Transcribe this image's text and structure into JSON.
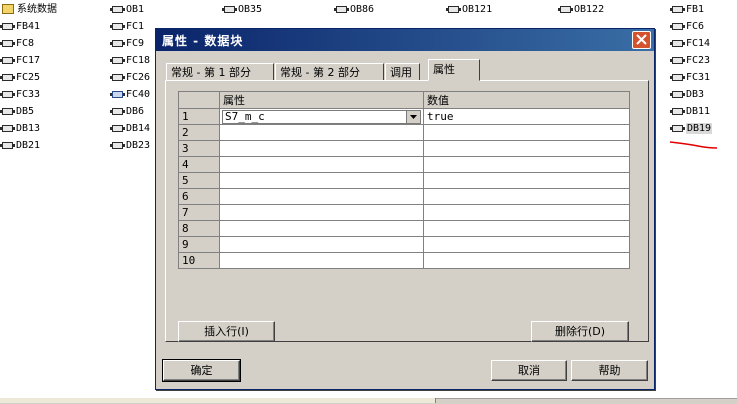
{
  "background_blocks": {
    "col1": [
      {
        "label": "系统数据",
        "icon": "system-data-folder-icon"
      },
      {
        "label": "FB41",
        "icon": "block-icon"
      },
      {
        "label": "FC8",
        "icon": "block-icon"
      },
      {
        "label": "FC17",
        "icon": "block-icon"
      },
      {
        "label": "FC25",
        "icon": "block-icon"
      },
      {
        "label": "FC33",
        "icon": "block-icon"
      },
      {
        "label": "DB5",
        "icon": "block-icon"
      },
      {
        "label": "DB13",
        "icon": "block-icon"
      },
      {
        "label": "DB21",
        "icon": "block-icon"
      }
    ],
    "col2": [
      {
        "label": "OB1",
        "icon": "block-icon"
      },
      {
        "label": "FC1",
        "icon": "block-icon"
      },
      {
        "label": "FC9",
        "icon": "block-icon"
      },
      {
        "label": "FC18",
        "icon": "block-icon"
      },
      {
        "label": "FC26",
        "icon": "block-icon"
      },
      {
        "label": "FC40",
        "icon": "special-fc-icon"
      },
      {
        "label": "DB6",
        "icon": "block-icon"
      },
      {
        "label": "DB14",
        "icon": "block-icon"
      },
      {
        "label": "DB23",
        "icon": "block-icon"
      }
    ],
    "top_row": [
      {
        "label": "OB35",
        "icon": "block-icon"
      },
      {
        "label": "OB86",
        "icon": "block-icon"
      },
      {
        "label": "OB121",
        "icon": "block-icon"
      },
      {
        "label": "OB122",
        "icon": "block-icon"
      }
    ],
    "col_right": [
      {
        "label": "FB1",
        "icon": "block-icon"
      },
      {
        "label": "FC6",
        "icon": "block-icon"
      },
      {
        "label": "FC14",
        "icon": "block-icon"
      },
      {
        "label": "FC23",
        "icon": "block-icon"
      },
      {
        "label": "FC31",
        "icon": "block-icon"
      },
      {
        "label": "DB3",
        "icon": "block-icon"
      },
      {
        "label": "DB11",
        "icon": "block-icon"
      },
      {
        "label": "DB19",
        "icon": "block-icon",
        "selected": true
      }
    ]
  },
  "dialog": {
    "title": "属性 - 数据块",
    "close_icon": "close-icon",
    "tabs": [
      {
        "label": "常规 - 第 1 部分",
        "active": false
      },
      {
        "label": "常规 - 第 2 部分",
        "active": false
      },
      {
        "label": "调用",
        "active": false
      },
      {
        "label": "属性",
        "active": true
      }
    ],
    "grid": {
      "headers": [
        "属性",
        "数值"
      ],
      "rows": [
        {
          "num": "1",
          "attr": "S7_m_c",
          "value": "true"
        },
        {
          "num": "2",
          "attr": "",
          "value": ""
        },
        {
          "num": "3",
          "attr": "",
          "value": ""
        },
        {
          "num": "4",
          "attr": "",
          "value": ""
        },
        {
          "num": "5",
          "attr": "",
          "value": ""
        },
        {
          "num": "6",
          "attr": "",
          "value": ""
        },
        {
          "num": "7",
          "attr": "",
          "value": ""
        },
        {
          "num": "8",
          "attr": "",
          "value": ""
        },
        {
          "num": "9",
          "attr": "",
          "value": ""
        },
        {
          "num": "10",
          "attr": "",
          "value": ""
        }
      ]
    },
    "buttons": {
      "insert_row": "插入行(I)",
      "delete_row": "删除行(D)",
      "ok": "确定",
      "cancel": "取消",
      "help": "帮助"
    }
  },
  "colors": {
    "title_bar": "#0a246a",
    "dialog_face": "#d4d0c8",
    "close_button": "#d4532f",
    "annotation_red": "#e00000"
  }
}
